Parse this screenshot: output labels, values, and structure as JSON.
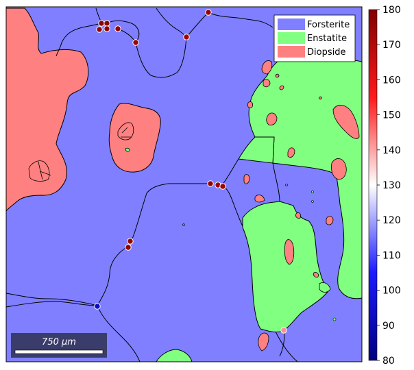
{
  "legend": {
    "items": [
      {
        "label": "Forsterite",
        "color": "#7f7fff"
      },
      {
        "label": "Enstatite",
        "color": "#80ff80"
      },
      {
        "label": "Diopside",
        "color": "#ff8080"
      }
    ]
  },
  "scalebar": {
    "label": "750 μm",
    "background": "#3a3d6b"
  },
  "colorbar": {
    "min": 80,
    "max": 180,
    "ticks": [
      "180",
      "170",
      "160",
      "150",
      "140",
      "130",
      "120",
      "110",
      "100",
      "90",
      "80"
    ],
    "colormap": [
      "#000080",
      "#1a1aff",
      "#ffffff",
      "#ff1a1a",
      "#800000"
    ]
  },
  "triple_junctions": [
    {
      "value": 178
    },
    {
      "value": 178
    },
    {
      "value": 176
    },
    {
      "value": 177
    },
    {
      "value": 176
    },
    {
      "value": 175
    },
    {
      "value": 174
    },
    {
      "value": 176
    },
    {
      "value": 177
    },
    {
      "value": 175
    },
    {
      "value": 174
    },
    {
      "value": 176
    },
    {
      "value": 177
    },
    {
      "value": 92
    },
    {
      "value": 142
    }
  ]
}
